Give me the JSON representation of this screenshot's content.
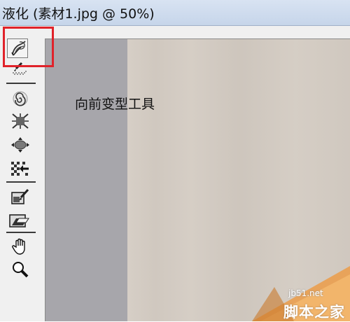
{
  "window": {
    "title": "液化 (素材1.jpg @ 50%)"
  },
  "toolbar": {
    "tools": [
      {
        "name": "forward-warp-tool",
        "icon": "forward-warp-icon",
        "selected": true
      },
      {
        "name": "reconstruct-tool",
        "icon": "reconstruct-brush-icon"
      },
      {
        "name": "twirl-clockwise-tool",
        "icon": "twirl-icon"
      },
      {
        "name": "pucker-tool",
        "icon": "pucker-icon"
      },
      {
        "name": "bloat-tool",
        "icon": "bloat-icon"
      },
      {
        "name": "push-left-tool",
        "icon": "push-left-icon"
      },
      {
        "name": "freeze-mask-tool",
        "icon": "freeze-mask-icon"
      },
      {
        "name": "thaw-mask-tool",
        "icon": "thaw-mask-icon"
      },
      {
        "name": "hand-tool",
        "icon": "hand-icon"
      },
      {
        "name": "zoom-tool",
        "icon": "zoom-icon"
      }
    ]
  },
  "annotation": {
    "text": "向前变型工具",
    "highlight_color": "#e0222a"
  },
  "watermark": {
    "site": "jb51.net",
    "name": "脚本之家"
  }
}
